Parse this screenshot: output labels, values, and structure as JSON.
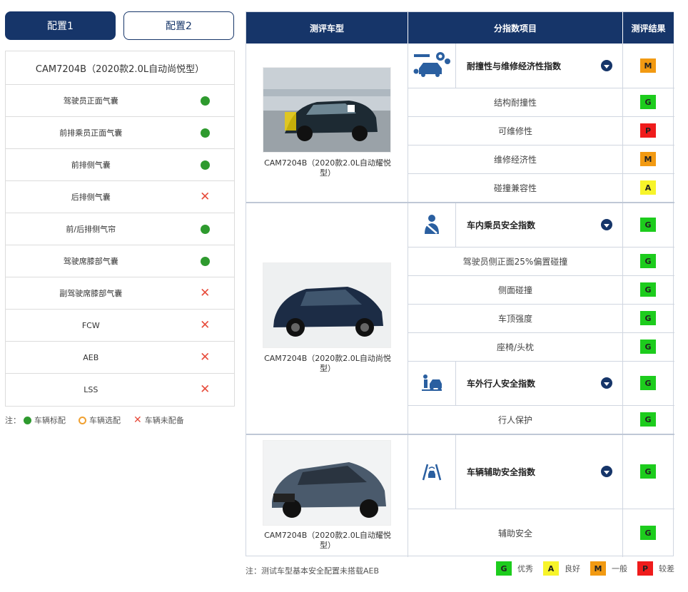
{
  "tabs": [
    {
      "label": "配置1"
    },
    {
      "label": "配置2"
    }
  ],
  "config": {
    "model": "CAM7204B（2020款2.0L自动尚悦型）",
    "items": [
      {
        "label": "驾驶员正面气囊",
        "status": "standard"
      },
      {
        "label": "前排乘员正面气囊",
        "status": "standard"
      },
      {
        "label": "前排侧气囊",
        "status": "standard"
      },
      {
        "label": "后排侧气囊",
        "status": "none"
      },
      {
        "label": "前/后排侧气帘",
        "status": "standard"
      },
      {
        "label": "驾驶席膝部气囊",
        "status": "standard"
      },
      {
        "label": "副驾驶席膝部气囊",
        "status": "none"
      },
      {
        "label": "FCW",
        "status": "none"
      },
      {
        "label": "AEB",
        "status": "none"
      },
      {
        "label": "LSS",
        "status": "none"
      }
    ],
    "note_prefix": "注：",
    "legend": {
      "standard": "车辆标配",
      "optional": "车辆选配",
      "none": "车辆未配备"
    }
  },
  "table": {
    "headers": {
      "model": "测评车型",
      "items": "分指数项目",
      "result": "测评结果"
    },
    "cars": [
      {
        "caption": "CAM7204B（2020款2.0L自动耀悦型）"
      },
      {
        "caption": "CAM7204B（2020款2.0L自动尚悦型）"
      },
      {
        "caption": "CAM7204B（2020款2.0L自动耀悦型）"
      }
    ],
    "groups": [
      {
        "title": "耐撞性与维修经济性指数",
        "grade": "M",
        "icon": "repair-tools-icon"
      },
      {
        "title": "车内乘员安全指数",
        "grade": "G",
        "icon": "seatbelt-occupant-icon"
      },
      {
        "title": "车外行人安全指数",
        "grade": "G",
        "icon": "pedestrian-icon"
      },
      {
        "title": "车辆辅助安全指数",
        "grade": "G",
        "icon": "lane-assist-icon"
      }
    ],
    "subitems": [
      {
        "label": "结构耐撞性",
        "grade": "G"
      },
      {
        "label": "可维修性",
        "grade": "P"
      },
      {
        "label": "维修经济性",
        "grade": "M"
      },
      {
        "label": "碰撞兼容性",
        "grade": "A"
      },
      {
        "label": "驾驶员侧正面25%偏置碰撞",
        "grade": "G"
      },
      {
        "label": "侧面碰撞",
        "grade": "G"
      },
      {
        "label": "车顶强度",
        "grade": "G"
      },
      {
        "label": "座椅/头枕",
        "grade": "G"
      },
      {
        "label": "行人保护",
        "grade": "G"
      },
      {
        "label": "辅助安全",
        "grade": "G"
      }
    ]
  },
  "footer": {
    "note": "注：测试车型基本安全配置未搭载AEB",
    "legend": [
      {
        "grade": "G",
        "label": "优秀"
      },
      {
        "grade": "A",
        "label": "良好"
      },
      {
        "grade": "M",
        "label": "一般"
      },
      {
        "grade": "P",
        "label": "较差"
      }
    ]
  },
  "colors": {
    "navy": "#163569",
    "good": "#1dcc1d",
    "acceptable": "#f7f42a",
    "marginal": "#f29a12",
    "poor": "#ef1c1c",
    "standard_dot": "#2e9a2e",
    "none_x": "#e74c3c"
  }
}
